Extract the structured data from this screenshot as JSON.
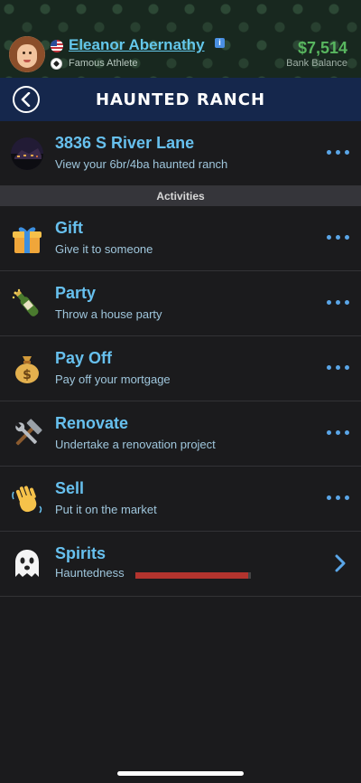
{
  "status": {
    "name": "Eleanor Abernathy",
    "occupation": "Famous Athlete",
    "balance": "$7,514",
    "balance_label": "Bank Balance"
  },
  "header": {
    "title": "HAUNTED RANCH"
  },
  "property": {
    "title": "3836 S River Lane",
    "subtitle": "View your 6br/4ba haunted ranch"
  },
  "section_label": "Activities",
  "activities": [
    {
      "title": "Gift",
      "subtitle": "Give it to someone",
      "icon": "gift-icon"
    },
    {
      "title": "Party",
      "subtitle": "Throw a house party",
      "icon": "champagne-icon"
    },
    {
      "title": "Pay Off",
      "subtitle": "Pay off your mortgage",
      "icon": "money-bag-icon"
    },
    {
      "title": "Renovate",
      "subtitle": "Undertake a renovation project",
      "icon": "tools-icon"
    },
    {
      "title": "Sell",
      "subtitle": "Put it on the market",
      "icon": "waving-hand-icon"
    }
  ],
  "spirits": {
    "title": "Spirits",
    "subtitle": "Hauntedness",
    "hauntedness_level": 0.98,
    "icon": "ghost-icon"
  },
  "colors": {
    "accent": "#67c0ee",
    "balance": "#58b65f",
    "header_bg": "#15274c",
    "bar": "#b3342e"
  }
}
